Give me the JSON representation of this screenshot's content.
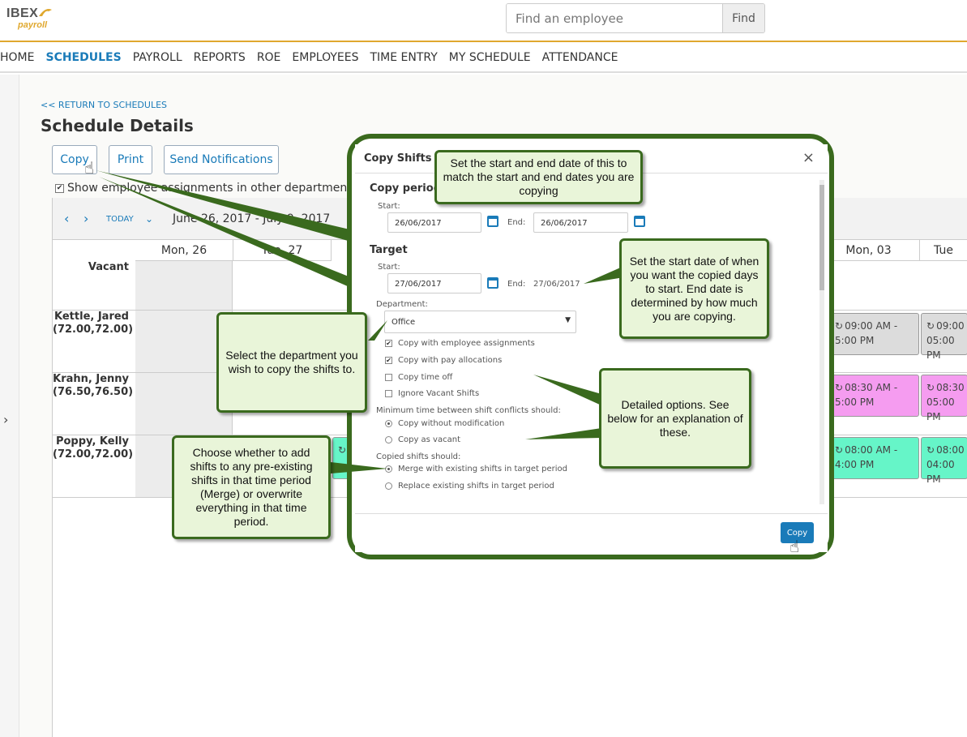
{
  "app": {
    "logo_text": "IBEX",
    "logo_sub": "payroll"
  },
  "search": {
    "placeholder": "Find an employee",
    "button": "Find"
  },
  "nav": [
    "HOME",
    "SCHEDULES",
    "PAYROLL",
    "REPORTS",
    "ROE",
    "EMPLOYEES",
    "TIME ENTRY",
    "MY SCHEDULE",
    "ATTENDANCE"
  ],
  "nav_active": "SCHEDULES",
  "page": {
    "return_link": "<< RETURN TO SCHEDULES",
    "title": "Schedule Details",
    "buttons": {
      "copy": "Copy",
      "print": "Print",
      "notify": "Send Notifications"
    },
    "show_other_depts": "Show employee assignments in other departments",
    "toolbar": {
      "today": "TODAY",
      "range": "June 26, 2017 - July 9, 2017"
    }
  },
  "grid": {
    "days": [
      "Mon, 26",
      "Tue, 27",
      "Mon, 03",
      "Tue"
    ],
    "rows": [
      {
        "name": "Vacant",
        "hours": ""
      },
      {
        "name": "Kettle, Jared",
        "hours": "(72.00,72.00)"
      },
      {
        "name": "Krahn, Jenny",
        "hours": "(76.50,76.50)"
      },
      {
        "name": "Poppy, Kelly",
        "hours": "(72.00,72.00)"
      }
    ],
    "shifts": {
      "kettle_a": {
        "time1": "09:00 AM -",
        "time2": "5:00 PM"
      },
      "kettle_b": {
        "time1": "09:00",
        "time2": "05:00 PM"
      },
      "krahn_a": {
        "time1": "08:30 AM -",
        "time2": "5:00 PM"
      },
      "krahn_b": {
        "time1": "08:30",
        "time2": "05:00 PM"
      },
      "poppy_a": {
        "time1": "08:00 AM -",
        "time2": "4:00 PM"
      },
      "poppy_b": {
        "time1": "08:00",
        "time2": "04:00 PM"
      }
    },
    "shift_colors": {
      "grey": "#dcdcdc",
      "pink": "#f59cf0",
      "green": "#66f5c8"
    }
  },
  "modal": {
    "title": "Copy Shifts",
    "close": "×",
    "copy_period": "Copy period",
    "start_label": "Start:",
    "end_label": "End:",
    "copy_start": "26/06/2017",
    "copy_end": "26/06/2017",
    "target": "Target",
    "target_start": "27/06/2017",
    "target_end": "27/06/2017",
    "department_label": "Department:",
    "department": "Office",
    "options": [
      {
        "label": "Copy with employee assignments",
        "checked": true
      },
      {
        "label": "Copy with pay allocations",
        "checked": true
      },
      {
        "label": "Copy time off",
        "checked": false
      },
      {
        "label": "Ignore Vacant Shifts",
        "checked": false
      }
    ],
    "min_time_label": "Minimum time between shift conflicts should:",
    "min_time_options": [
      {
        "label": "Copy without modification",
        "selected": true
      },
      {
        "label": "Copy as vacant",
        "selected": false
      }
    ],
    "copied_label": "Copied shifts should:",
    "copied_options": [
      {
        "label": "Merge with existing shifts in target period",
        "selected": true
      },
      {
        "label": "Replace existing shifts in target period",
        "selected": false
      }
    ],
    "copy_button": "Copy"
  },
  "callouts": {
    "copy_period": "Set the start and end date of this to match the start and end dates you are copying",
    "target": "Set the start date of when you want the copied days to start. End date is determined by how much you are copying.",
    "department": "Select the department you wish to copy the shifts to.",
    "options": "Detailed options. See below for an explanation of these.",
    "merge": "Choose whether to add shifts to any pre-existing shifts in that time period (Merge) or overwrite everything in that time period."
  },
  "colors": {
    "accent": "#1a7bb9",
    "brand_gold": "#e0a82e",
    "callout_border": "#3a6a1e",
    "callout_fill": "#e9f5d9"
  }
}
